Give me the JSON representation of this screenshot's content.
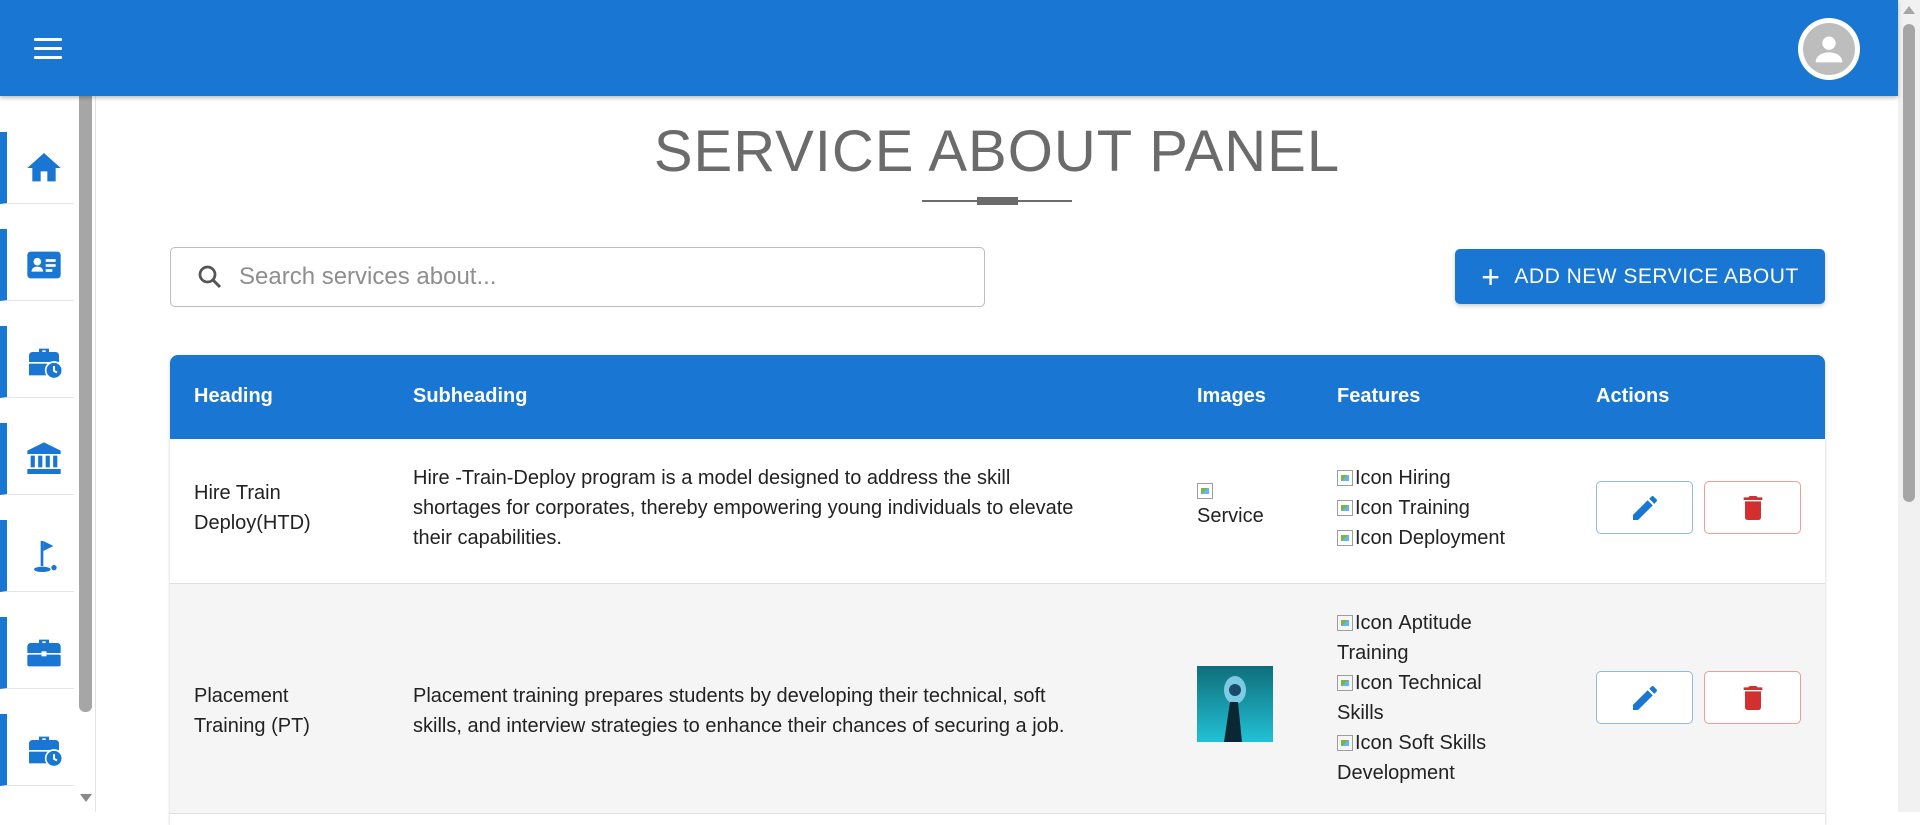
{
  "appbar": {
    "menu_icon": "hamburger-menu-icon",
    "avatar_icon": "account-circle-icon",
    "color": "#1976d2"
  },
  "sidebar": {
    "items": [
      {
        "icon": "home-icon"
      },
      {
        "icon": "id-card-icon"
      },
      {
        "icon": "briefcase-clock-icon"
      },
      {
        "icon": "bank-icon"
      },
      {
        "icon": "golf-flag-icon"
      },
      {
        "icon": "briefcase-icon"
      },
      {
        "icon": "briefcase-clock-icon"
      }
    ]
  },
  "main": {
    "title": "SERVICE ABOUT PANEL",
    "search": {
      "placeholder": "Search services about..."
    },
    "add_button": {
      "label": "ADD NEW SERVICE ABOUT",
      "icon": "plus-icon"
    },
    "table": {
      "headers": [
        "Heading",
        "Subheading",
        "Images",
        "Features",
        "Actions"
      ],
      "rows": [
        {
          "heading_line1": "Hire Train",
          "heading_line2": "Deploy(HTD)",
          "subheading_lines": [
            "Hire -Train-Deploy program is a model designed to address the skill",
            "shortages for corporates, thereby empowering young individuals to elevate",
            "their capabilities."
          ],
          "image_alt": "Service",
          "features": [
            {
              "alt": "Icon",
              "text": "Hiring"
            },
            {
              "alt": "Icon",
              "text": "Training"
            },
            {
              "alt": "Icon",
              "text": "Deployment"
            }
          ]
        },
        {
          "heading_line1": "Placement",
          "heading_line2": "Training (PT)",
          "subheading_lines": [
            "Placement training prepares students by developing their technical, soft",
            "skills, and interview strategies to enhance their chances of securing a job."
          ],
          "features": [
            {
              "alt": "Icon",
              "text_line1": "Aptitude",
              "text_line2": "Training"
            },
            {
              "alt": "Icon",
              "text_line1": "Technical",
              "text_line2": "Skills"
            },
            {
              "alt": "Icon",
              "text_line1": "Soft Skills",
              "text_line2": "Development"
            }
          ]
        }
      ],
      "edit_icon": "pencil-icon",
      "delete_icon": "trash-icon"
    }
  },
  "colors": {
    "primary": "#1976d2",
    "danger": "#d32f2f",
    "title": "#6b6b6b"
  }
}
